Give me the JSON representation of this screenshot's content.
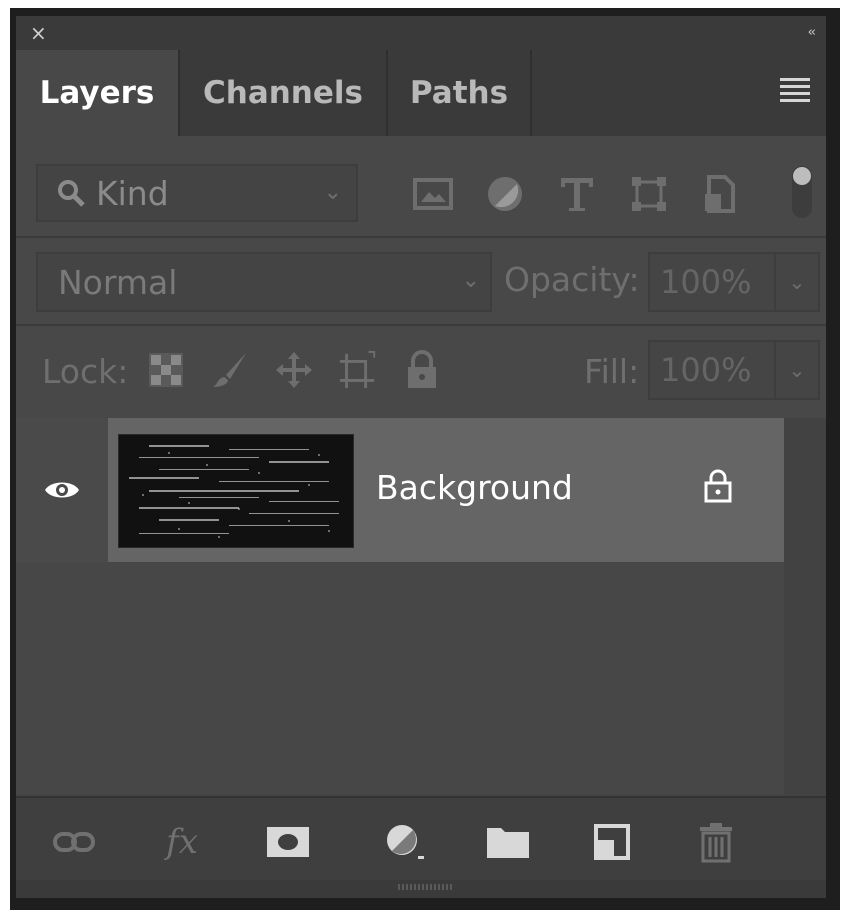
{
  "panel": {
    "close_glyph": "×",
    "collapse_glyph": "‹‹"
  },
  "tabs": [
    {
      "label": "Layers",
      "active": true
    },
    {
      "label": "Channels",
      "active": false
    },
    {
      "label": "Paths",
      "active": false
    }
  ],
  "filter": {
    "kind_label": "Kind",
    "icons": [
      "image-filter-icon",
      "adjustment-filter-icon",
      "type-filter-icon",
      "shape-filter-icon",
      "smart-object-filter-icon"
    ]
  },
  "blend": {
    "mode": "Normal",
    "opacity_label": "Opacity:",
    "opacity_value": "100%"
  },
  "lock": {
    "label": "Lock:",
    "icons": [
      "lock-transparent-pixels-icon",
      "lock-image-pixels-icon",
      "lock-position-icon",
      "lock-artboard-icon",
      "lock-all-icon"
    ],
    "fill_label": "Fill:",
    "fill_value": "100%"
  },
  "layers": [
    {
      "name": "Background",
      "visible": true,
      "locked": true
    }
  ],
  "bottom_icons": [
    "link-layers-icon",
    "layer-style-icon",
    "layer-mask-icon",
    "adjustment-layer-icon",
    "group-folder-icon",
    "new-layer-icon",
    "delete-layer-icon"
  ],
  "bottom_labels": {
    "fx": "fx"
  }
}
